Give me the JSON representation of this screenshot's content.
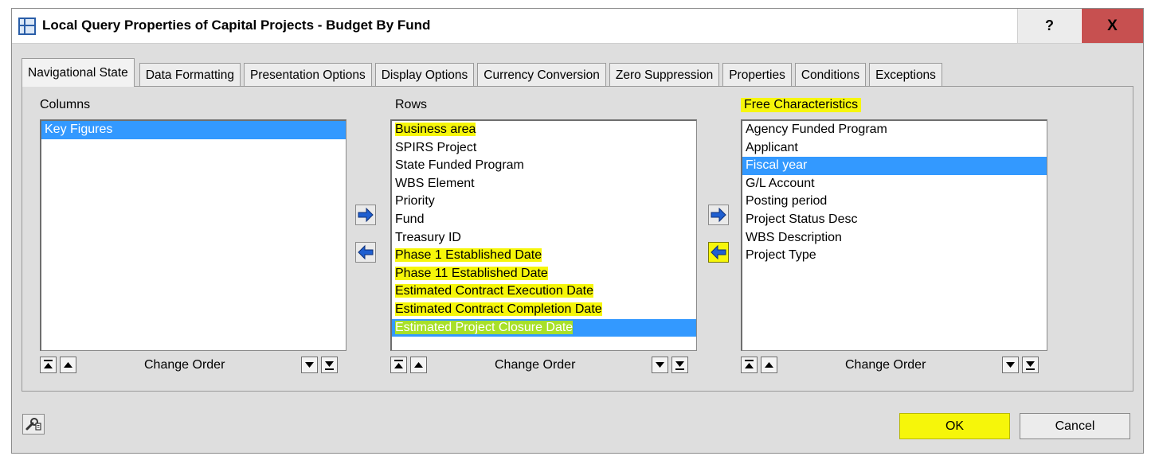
{
  "window": {
    "title": "Local Query Properties of Capital Projects - Budget By Fund",
    "help_label": "?",
    "close_label": "X"
  },
  "tabs": [
    {
      "label": "Navigational State",
      "active": true
    },
    {
      "label": "Data Formatting"
    },
    {
      "label": "Presentation Options"
    },
    {
      "label": "Display Options"
    },
    {
      "label": "Currency Conversion"
    },
    {
      "label": "Zero Suppression"
    },
    {
      "label": "Properties"
    },
    {
      "label": "Conditions"
    },
    {
      "label": "Exceptions"
    }
  ],
  "columns": {
    "label": "Columns",
    "items": [
      "Key Figures"
    ],
    "selected_index": 0
  },
  "rows": {
    "label": "Rows",
    "items": [
      "Business area",
      "SPIRS Project",
      "State Funded Program",
      "WBS Element",
      "Priority",
      "Fund",
      "Treasury ID",
      "Phase 1 Established Date",
      "Phase 11 Established Date",
      "Estimated Contract Execution Date",
      "Estimated Contract Completion Date",
      "Estimated Project Closure Date"
    ],
    "selected_index": 11
  },
  "free_characteristics": {
    "label": "Free Characteristics",
    "items": [
      "Agency Funded Program",
      "Applicant",
      "Fiscal year",
      "G/L Account",
      "Posting period",
      "Project Status Desc",
      "WBS Description",
      "Project Type"
    ],
    "selected_index": 2
  },
  "change_order_label": "Change Order",
  "buttons": {
    "ok": "OK",
    "cancel": "Cancel"
  },
  "colors": {
    "selection": "#3399ff",
    "highlight": "#f6f60a",
    "close_button": "#c75050",
    "arrow": "#1f5fd0"
  },
  "icons": {
    "move_right": "arrow-right-icon",
    "move_left": "arrow-left-icon",
    "move_top": "move-to-top-icon",
    "move_up": "move-up-icon",
    "move_down": "move-down-icon",
    "move_bottom": "move-to-bottom-icon",
    "settings": "wrench-icon"
  }
}
